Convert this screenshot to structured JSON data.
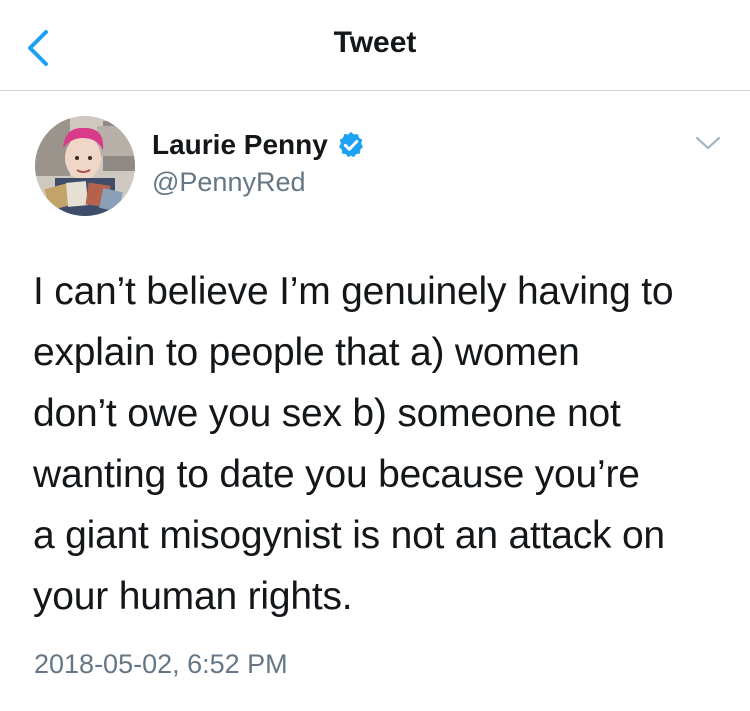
{
  "navbar": {
    "title": "Tweet",
    "back_icon": "chevron-left-icon"
  },
  "author": {
    "name": "Laurie Penny",
    "handle": "@PennyRed",
    "verified_icon": "verified-badge-icon"
  },
  "tweet": {
    "text_lines": [
      "I can’t believe I’m genuinely having to",
      "explain to people that a) women",
      "don’t owe you sex b) someone not",
      "wanting to date you because you’re",
      "a giant misogynist is not an attack on",
      "your human rights."
    ],
    "timestamp": "2018-05-02, 6:52 PM"
  },
  "colors": {
    "accent": "#1da1f2",
    "text": "#14171a",
    "secondary_text": "#657786",
    "divider": "#cfd4d9"
  }
}
